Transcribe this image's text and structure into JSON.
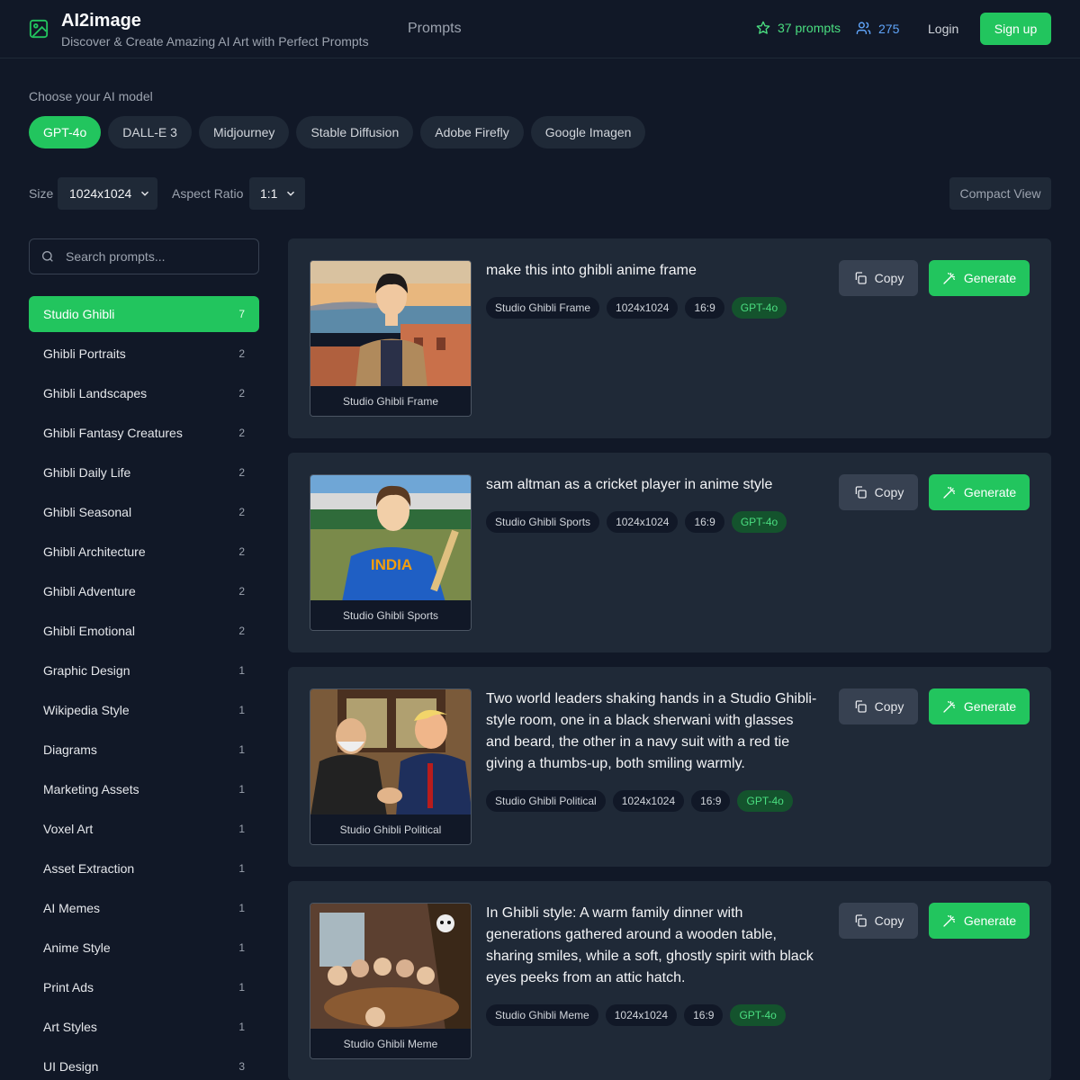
{
  "header": {
    "title": "AI2image",
    "subtitle": "Discover & Create Amazing AI Art with Perfect Prompts",
    "nav_prompts": "Prompts",
    "prompt_count": "37 prompts",
    "user_count": "275",
    "login": "Login",
    "signup": "Sign up",
    "logo_icon": "image-icon"
  },
  "models": {
    "label": "Choose your AI model",
    "items": [
      "GPT-4o",
      "DALL-E 3",
      "Midjourney",
      "Stable Diffusion",
      "Adobe Firefly",
      "Google Imagen"
    ],
    "selected": "GPT-4o"
  },
  "options": {
    "size_label": "Size",
    "size_value": "1024x1024",
    "ratio_label": "Aspect Ratio",
    "ratio_value": "1:1",
    "compact_view": "Compact View"
  },
  "search": {
    "placeholder": "Search prompts..."
  },
  "categories": [
    {
      "label": "Studio Ghibli",
      "count": "7"
    },
    {
      "label": "Ghibli Portraits",
      "count": "2"
    },
    {
      "label": "Ghibli Landscapes",
      "count": "2"
    },
    {
      "label": "Ghibli Fantasy Creatures",
      "count": "2"
    },
    {
      "label": "Ghibli Daily Life",
      "count": "2"
    },
    {
      "label": "Ghibli Seasonal",
      "count": "2"
    },
    {
      "label": "Ghibli Architecture",
      "count": "2"
    },
    {
      "label": "Ghibli Adventure",
      "count": "2"
    },
    {
      "label": "Ghibli Emotional",
      "count": "2"
    },
    {
      "label": "Graphic Design",
      "count": "1"
    },
    {
      "label": "Wikipedia Style",
      "count": "1"
    },
    {
      "label": "Diagrams",
      "count": "1"
    },
    {
      "label": "Marketing Assets",
      "count": "1"
    },
    {
      "label": "Voxel Art",
      "count": "1"
    },
    {
      "label": "Asset Extraction",
      "count": "1"
    },
    {
      "label": "AI Memes",
      "count": "1"
    },
    {
      "label": "Anime Style",
      "count": "1"
    },
    {
      "label": "Print Ads",
      "count": "1"
    },
    {
      "label": "Art Styles",
      "count": "1"
    },
    {
      "label": "UI Design",
      "count": "3"
    }
  ],
  "buttons": {
    "copy": "Copy",
    "generate": "Generate"
  },
  "prompts": [
    {
      "text": "make this into ghibli anime frame",
      "caption": "Studio Ghibli Frame",
      "tags": [
        "Studio Ghibli Frame",
        "1024x1024",
        "16:9",
        "GPT-4o"
      ]
    },
    {
      "text": "sam altman as a cricket player in anime style",
      "caption": "Studio Ghibli Sports",
      "tags": [
        "Studio Ghibli Sports",
        "1024x1024",
        "16:9",
        "GPT-4o"
      ],
      "jersey_text": "INDIA"
    },
    {
      "text": "Two world leaders shaking hands in a Studio Ghibli-style room, one in a black sherwani with glasses and beard, the other in a navy suit with a red tie giving a thumbs-up, both smiling warmly.",
      "caption": "Studio Ghibli Political",
      "tags": [
        "Studio Ghibli Political",
        "1024x1024",
        "16:9",
        "GPT-4o"
      ]
    },
    {
      "text": "In Ghibli style: A warm family dinner with generations gathered around a wooden table, sharing smiles, while a soft, ghostly spirit with black eyes peeks from an attic hatch.",
      "caption": "Studio Ghibli Meme",
      "tags": [
        "Studio Ghibli Meme",
        "1024x1024",
        "16:9",
        "GPT-4o"
      ]
    }
  ]
}
